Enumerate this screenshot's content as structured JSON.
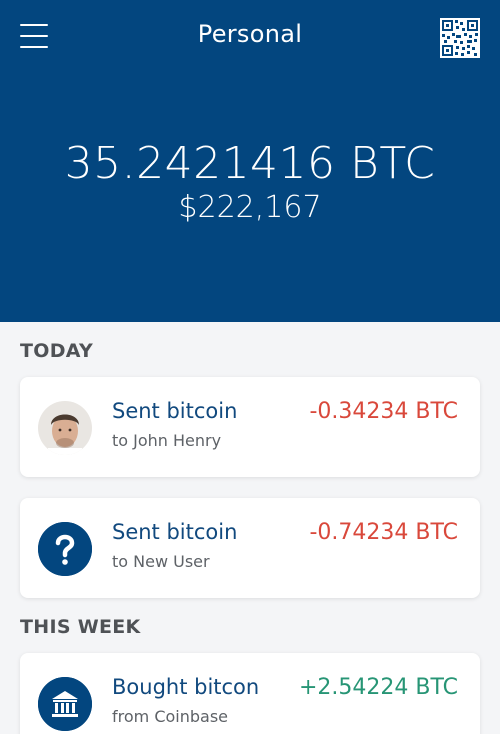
{
  "header": {
    "title": "Personal",
    "menu_icon": "hamburger-menu-icon",
    "qr_icon": "qr-code-icon",
    "background": "#03467f"
  },
  "balance": {
    "btc": "35.2421416 BTC",
    "usd": "$222,167"
  },
  "sections": {
    "today": "TODAY",
    "this_week": "THIS WEEK"
  },
  "transactions": [
    {
      "title": "Sent bitcoin",
      "subtitle": "to John Henry",
      "amount": "-0.34234 BTC",
      "icon": "user-avatar-photo",
      "direction": "negative"
    },
    {
      "title": "Sent bitcoin",
      "subtitle": "to New User",
      "amount": "-0.74234 BTC",
      "icon": "question-mark-icon",
      "direction": "negative"
    },
    {
      "title": "Bought bitcon",
      "subtitle": "from Coinbase",
      "amount": "+2.54224 BTC",
      "icon": "bank-icon",
      "direction": "positive"
    }
  ],
  "colors": {
    "negative": "#d9483b",
    "positive": "#279575",
    "title": "#11497e"
  }
}
